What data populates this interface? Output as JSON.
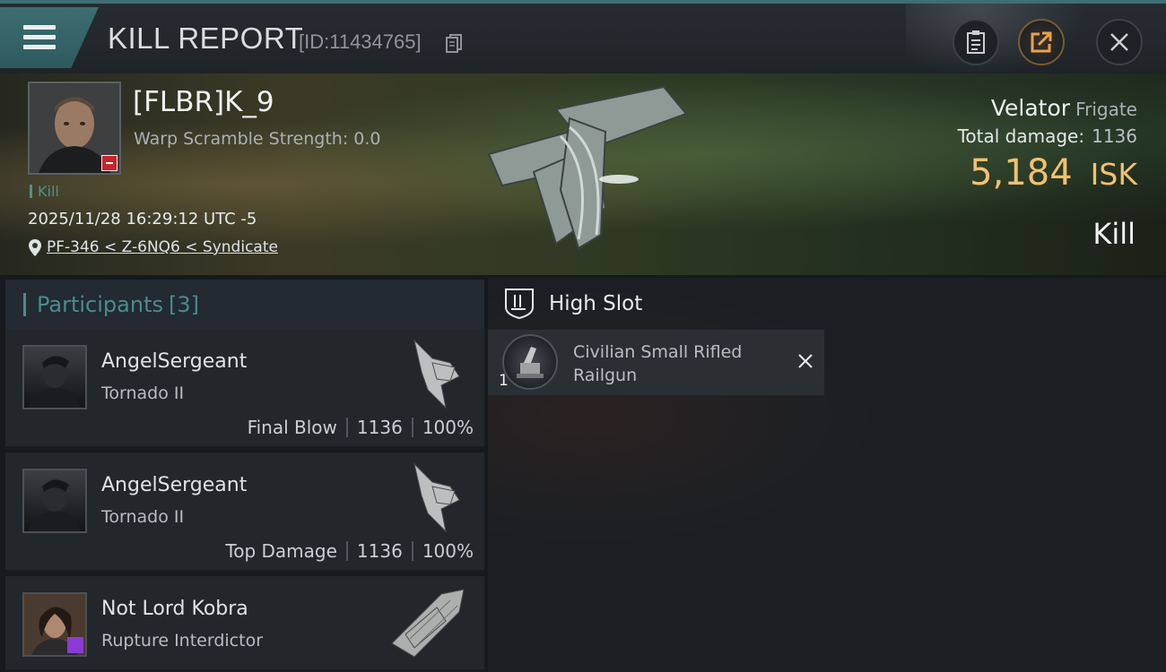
{
  "header": {
    "title": "KILL REPORT",
    "id_text": "[ID:11434765]"
  },
  "victim": {
    "name": "[FLBR]K_9",
    "warp_scramble": "Warp Scramble Strength: 0.0",
    "tag": "Kill",
    "datetime": "2025/11/28 16:29:12 UTC -5",
    "location": "PF-346 < Z-6NQ6 < Syndicate"
  },
  "ship": {
    "name": "Velator",
    "class": "Frigate",
    "total_damage_label": "Total damage:",
    "total_damage": "1136",
    "isk_value": "5,184",
    "isk_unit": "ISK",
    "result": "Kill"
  },
  "participants": {
    "label": "Participants",
    "count": "[3]",
    "items": [
      {
        "name": "AngelSergeant",
        "ship": "Tornado II",
        "role": "Final Blow",
        "damage": "1136",
        "percent": "100%"
      },
      {
        "name": "AngelSergeant",
        "ship": "Tornado II",
        "role": "Top Damage",
        "damage": "1136",
        "percent": "100%"
      },
      {
        "name": "Not Lord Kobra",
        "ship": "Rupture Interdictor"
      }
    ]
  },
  "fitting": {
    "slot_label": "High Slot",
    "items": [
      {
        "name": "Civilian Small Rifled Railgun",
        "qty": "1"
      }
    ]
  },
  "colors": {
    "accent_teal": "#4a8b8e",
    "isk_gold": "#f1c170",
    "loss_red": "#c8252a"
  },
  "icons": [
    "menu-icon",
    "copy-icon",
    "clipboard-icon",
    "share-icon",
    "close-icon",
    "location-pin-icon",
    "high-slot-icon",
    "remove-icon"
  ]
}
